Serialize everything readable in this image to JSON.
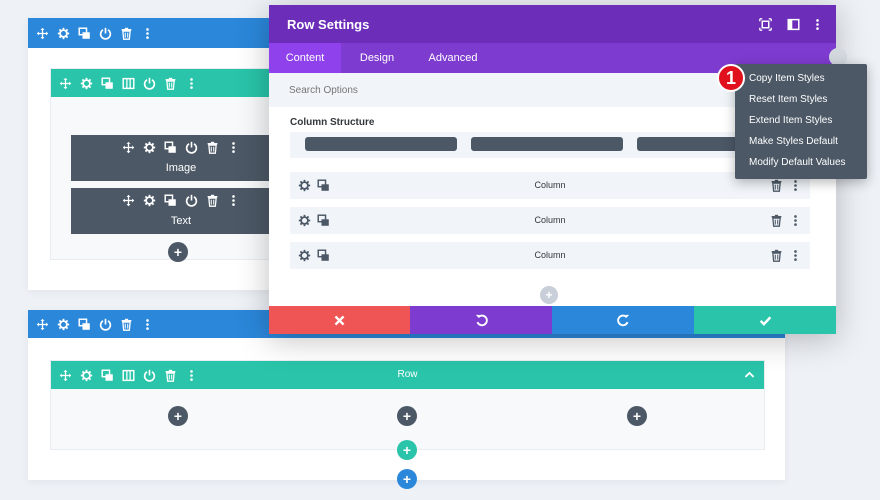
{
  "section1": {
    "modules": [
      {
        "label": "Image"
      },
      {
        "label": "Text"
      }
    ]
  },
  "section2": {
    "row_label": "Row"
  },
  "modal": {
    "title": "Row Settings",
    "tabs": [
      {
        "label": "Content"
      },
      {
        "label": "Design"
      },
      {
        "label": "Advanced"
      }
    ],
    "search_placeholder": "Search Options",
    "column_structure_label": "Column Structure",
    "columns": [
      {
        "label": "Column"
      },
      {
        "label": "Column"
      },
      {
        "label": "Column"
      }
    ]
  },
  "context_menu": {
    "items": [
      {
        "label": "Copy Item Styles"
      },
      {
        "label": "Reset Item Styles"
      },
      {
        "label": "Extend Item Styles"
      },
      {
        "label": "Make Styles Default"
      },
      {
        "label": "Modify Default Values"
      }
    ]
  },
  "badge": {
    "text": "1"
  },
  "colors": {
    "section_blue": "#2b87da",
    "row_green": "#29c4a9",
    "module_dark": "#4c5866",
    "modal_purple": "#6c2eb9",
    "tab_purple": "#7e3bd0",
    "cancel_red": "#ef5555",
    "undo_purple": "#7e3bd0",
    "redo_blue": "#2b87da",
    "save_green": "#29c4a9",
    "badge_red": "#e0101d"
  },
  "icons": {
    "move": "move-icon",
    "settings": "gear-icon",
    "duplicate": "duplicate-icon",
    "columns": "columns-icon",
    "power": "power-icon",
    "delete": "trash-icon",
    "more": "more-vertical-icon",
    "collapse": "chevron-up-icon",
    "add": "plus-icon",
    "close": "close-icon",
    "undo": "undo-icon",
    "redo": "redo-icon",
    "save": "check-icon"
  }
}
